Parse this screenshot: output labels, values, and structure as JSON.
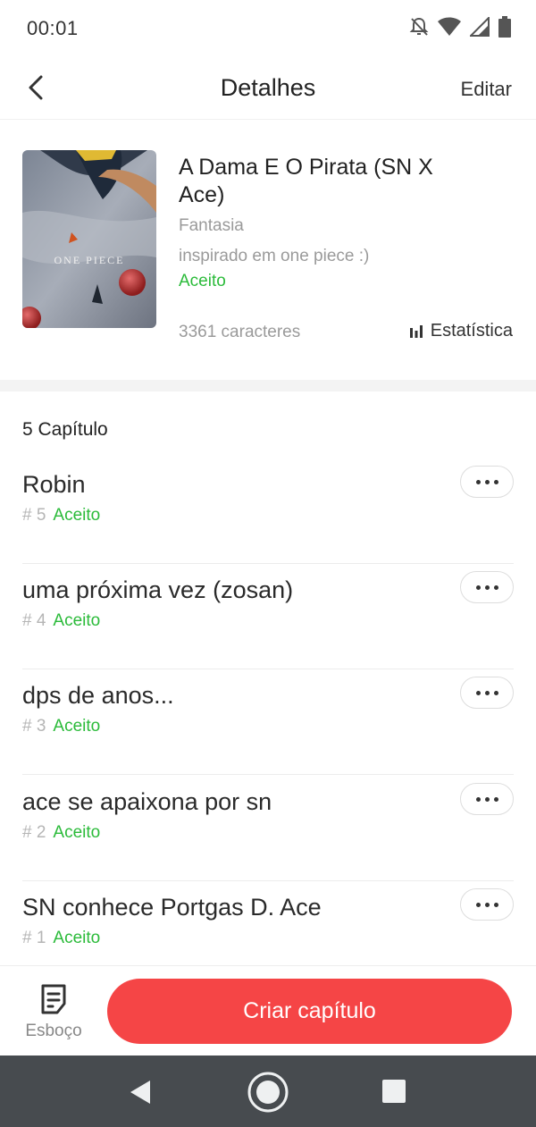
{
  "status_bar": {
    "time": "00:01",
    "icons": [
      "notifications-off-icon",
      "wifi-icon",
      "cell-signal-icon",
      "battery-icon"
    ]
  },
  "header": {
    "back_icon": "chevron-left-icon",
    "title": "Detalhes",
    "edit_label": "Editar"
  },
  "story": {
    "cover_text": "ONE PIECE",
    "title": "A Dama E O Pirata (SN X Ace)",
    "genre": "Fantasia",
    "description": "inspirado em one piece :)",
    "status": "Aceito",
    "characters": "3361 caracteres",
    "stats_label": "Estatística",
    "stats_icon": "bar-chart-icon"
  },
  "chapters": {
    "count_label": "5 Capítulo",
    "items": [
      {
        "title": "Robin",
        "number": "# 5",
        "status": "Aceito"
      },
      {
        "title": "uma próxima vez (zosan)",
        "number": "# 4",
        "status": "Aceito"
      },
      {
        "title": "dps de anos...",
        "number": "# 3",
        "status": "Aceito"
      },
      {
        "title": "ace se apaixona por sn",
        "number": "# 2",
        "status": "Aceito"
      },
      {
        "title": "SN conhece Portgas D. Ace",
        "number": "# 1",
        "status": "Aceito"
      }
    ]
  },
  "bottom_bar": {
    "draft_label": "Esboço",
    "draft_icon": "draft-note-icon",
    "create_label": "Criar capítulo"
  },
  "colors": {
    "accent_red": "#f54546",
    "accepted_green": "#2bbb3a",
    "nav_bar": "#474b4f"
  }
}
